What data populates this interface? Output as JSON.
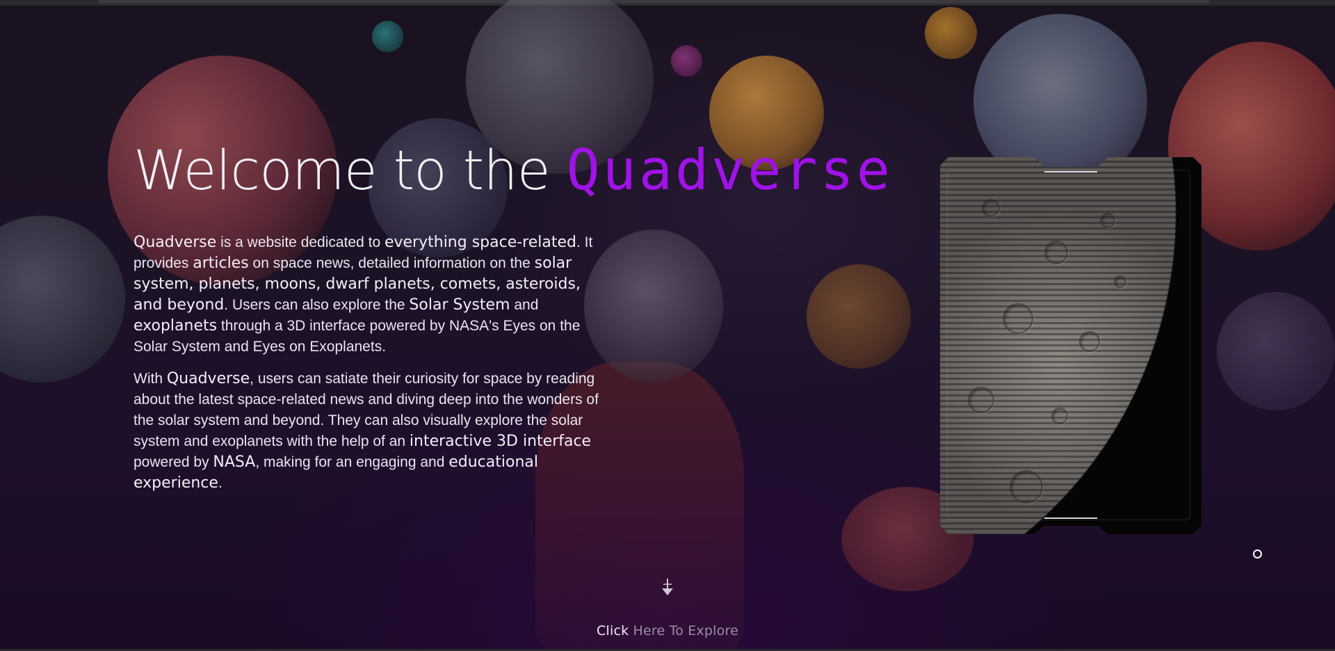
{
  "hero": {
    "title_prefix": "Welcome to the ",
    "title_brand": "Quadverse",
    "p1": {
      "s1_b": "Quadverse",
      "s1": " is a website dedicated to ",
      "s2_b": "everything space-related",
      "s2": ". It provides ",
      "s3_b": "articles",
      "s3": " on space news, detailed information on the ",
      "s4_b": "solar system, planets, moons, dwarf planets, comets, asteroids, and beyond",
      "s4": ". Users can also explore the ",
      "s5_b": "Solar System",
      "s5": " and ",
      "s6_b": "exoplanets",
      "s6": " through a 3D interface powered by NASA's Eyes on the Solar System and Eyes on Exoplanets."
    },
    "p2": {
      "s1": "With ",
      "s1_b": "Quadverse",
      "s2": ", users can satiate their curiosity for space by reading about the latest space-related news and diving deep into the wonders of the solar system and beyond. They can also visually explore the solar system and exoplanets with the help of an ",
      "s2_b": "interactive 3D interface",
      "s3": " powered by ",
      "s3_b": "NASA",
      "s4": ", making for an engaging and ",
      "s4_b": "educational experience",
      "s5": "."
    }
  },
  "explore": {
    "word1": "Click",
    "rest": " Here To Explore",
    "icon": "arrow-down-icon"
  },
  "colors": {
    "brand": "#a012e8",
    "background": "#1a1220"
  }
}
